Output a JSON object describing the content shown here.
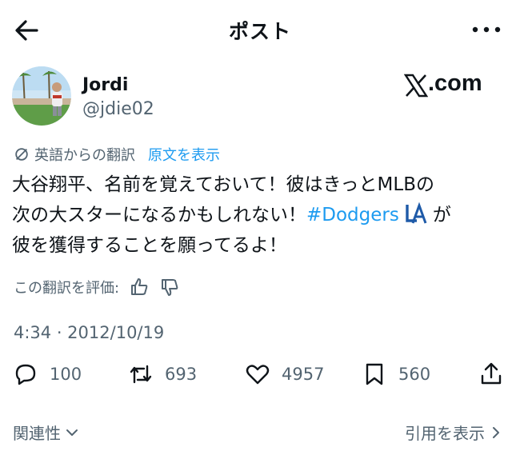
{
  "header": {
    "title": "ポスト",
    "back_icon": "arrow-left-icon",
    "more_icon": "more-dots-icon"
  },
  "user": {
    "name": "Jordi",
    "handle": "@jdie02"
  },
  "brand": {
    "logo_text": ".com"
  },
  "translation": {
    "label": "英語からの翻訳",
    "show_original": "原文を表示"
  },
  "post": {
    "line1": "大谷翔平、名前を覚えておいて！彼はきっとMLBの",
    "line2_prefix": "次の大スターになるかもしれない！",
    "hashtag": "#Dodgers",
    "line2_suffix": "が",
    "line3": "彼を獲得することを願ってるよ！"
  },
  "rating": {
    "label": "この翻訳を評価:"
  },
  "timestamp": "4:34 · 2012/10/19",
  "actions": {
    "replies": "100",
    "reposts": "693",
    "likes": "4957",
    "bookmarks": "560"
  },
  "footer": {
    "related": "関連性",
    "view_quotes": "引用を表示"
  },
  "colors": {
    "accent": "#1d9bf0",
    "secondary": "#536471",
    "text": "#0f1419"
  }
}
